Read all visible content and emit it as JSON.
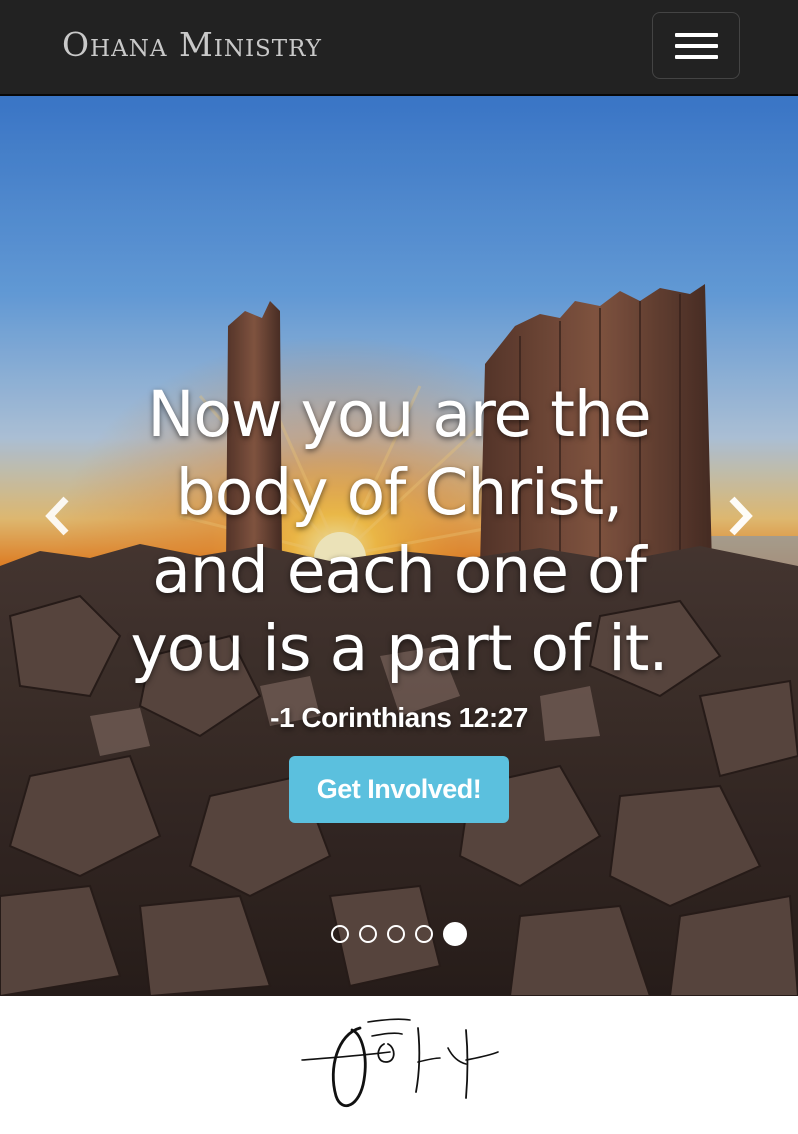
{
  "navbar": {
    "brand": "Ohana Ministry",
    "menu_icon": "hamburger-icon"
  },
  "carousel": {
    "quote": "Now you are the body of Christ, and each one of you is a part of it.",
    "reference": "-1 Corinthians 12:27",
    "cta_label": "Get Involved!",
    "prev_icon": "chevron-left-icon",
    "next_icon": "chevron-right-icon",
    "slide_count": 5,
    "active_slide": 5
  },
  "footer": {
    "logo_text": "오하나"
  },
  "colors": {
    "navbar_bg": "#222222",
    "brand_text": "#c9c9c9",
    "cta_bg": "#5bc0de",
    "sky_top": "#3f86dc",
    "sun": "#ffd15a"
  }
}
